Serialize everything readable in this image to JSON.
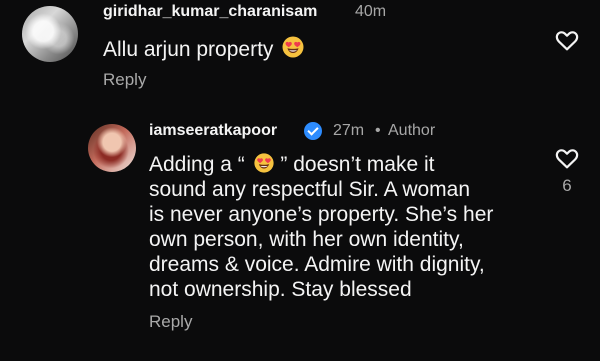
{
  "comments": [
    {
      "username": "giridhar_kumar_charanisam",
      "timestamp": "40m",
      "text": "Allu arjun property",
      "emoji": "heart-eyes-emoji",
      "reply_label": "Reply"
    },
    {
      "username": "iamseeratkapoor",
      "timestamp": "27m",
      "separator": "•",
      "author_label": "Author",
      "verified_icon": "verified-badge",
      "text_lines": [
        "Adding a “",
        "” doesn’t make it",
        "sound any respectful Sir. A woman",
        "is never anyone’s property. She’s her",
        "own person, with her own identity,",
        "dreams & voice. Admire with dignity,",
        "not ownership. Stay blessed"
      ],
      "like_count": "6",
      "reply_label": "Reply"
    }
  ],
  "colors": {
    "background": "#0b0b0c",
    "primary_text": "#f4f4f4",
    "secondary_text": "#a7a7a7",
    "verified_blue": "#2d8cff"
  },
  "icons": {
    "like": "heart-outline-icon",
    "emoji": "smiling-face-with-heart-eyes"
  }
}
